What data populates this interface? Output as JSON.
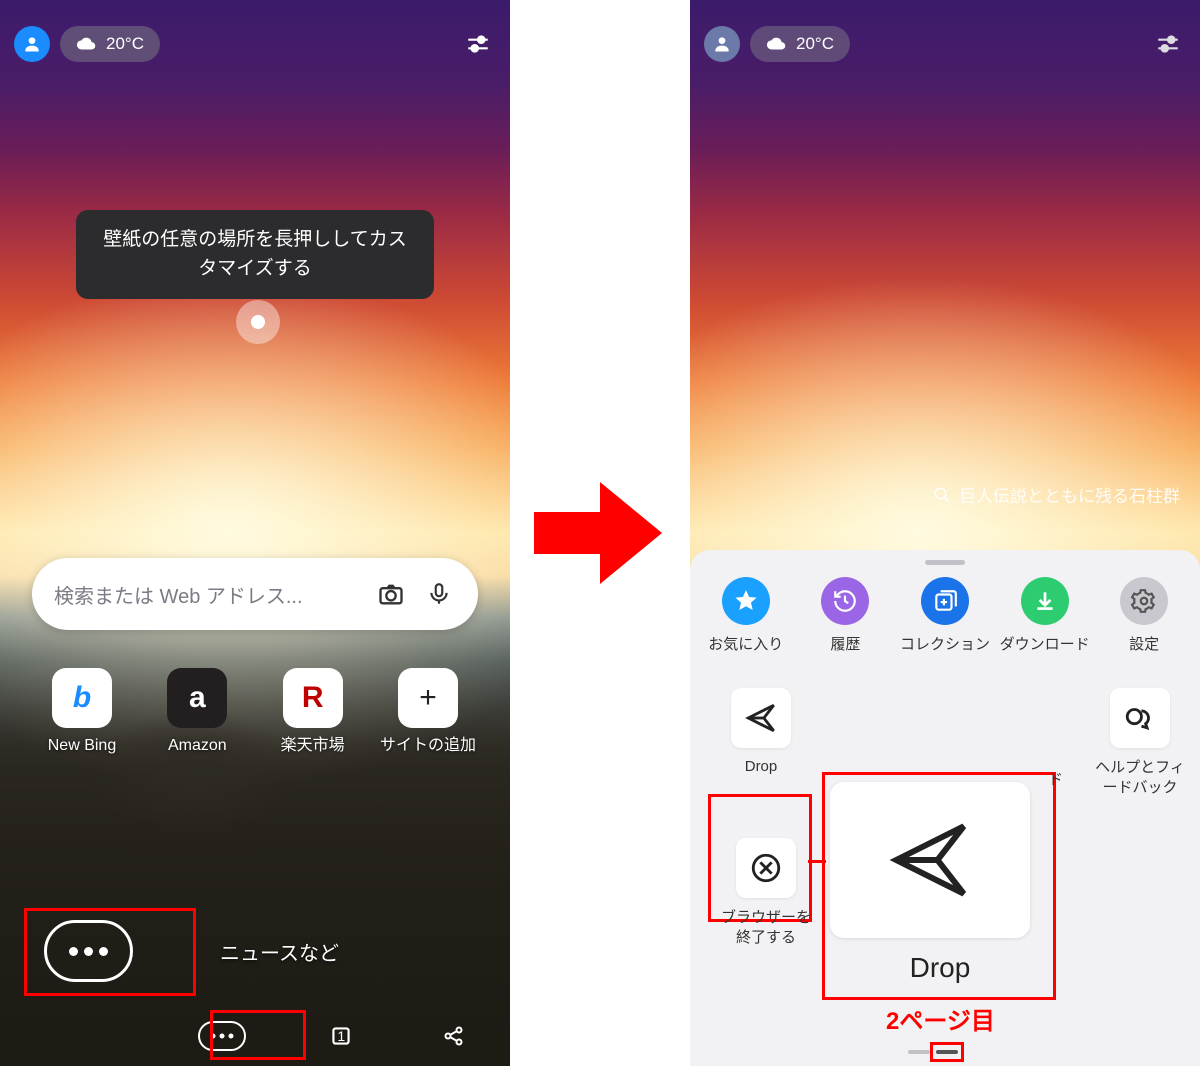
{
  "left": {
    "temperature": "20°C",
    "tooltip": "壁紙の任意の場所を長押ししてカスタマイズする",
    "search_placeholder": "検索または Web アドレス...",
    "quicklinks": [
      {
        "label": "New Bing",
        "glyph": "b",
        "color": "#1a8cff"
      },
      {
        "label": "Amazon",
        "glyph": "a",
        "bg": "#231f20",
        "color": "#fff"
      },
      {
        "label": "楽天市場",
        "glyph": "R",
        "color": "#bf0000"
      },
      {
        "label": "サイトの追加",
        "glyph": "+",
        "color": "#222"
      }
    ],
    "news_label": "ニュースなど",
    "tab_count": "1"
  },
  "right": {
    "temperature": "20°C",
    "search_hint": "巨人伝説とともに残る石柱群",
    "sheet_row1": [
      {
        "label": "お気に入り",
        "icon": "star",
        "bg": "#1aa0ff"
      },
      {
        "label": "履歴",
        "icon": "history",
        "bg": "#9a66e6"
      },
      {
        "label": "コレクション",
        "icon": "collection",
        "bg": "#1a73e8"
      },
      {
        "label": "ダウンロード",
        "icon": "download",
        "bg": "#2ecc71"
      },
      {
        "label": "設定",
        "icon": "gear",
        "bg": "#c0c0c6"
      }
    ],
    "grid": {
      "drop_small_label": "Drop",
      "drop_big_label": "Drop",
      "help_label": "ヘルプとフィードバック",
      "hidden_hint": "ド",
      "exit_label": "ブラウザーを終了する"
    },
    "page_label": "2ページ目"
  }
}
